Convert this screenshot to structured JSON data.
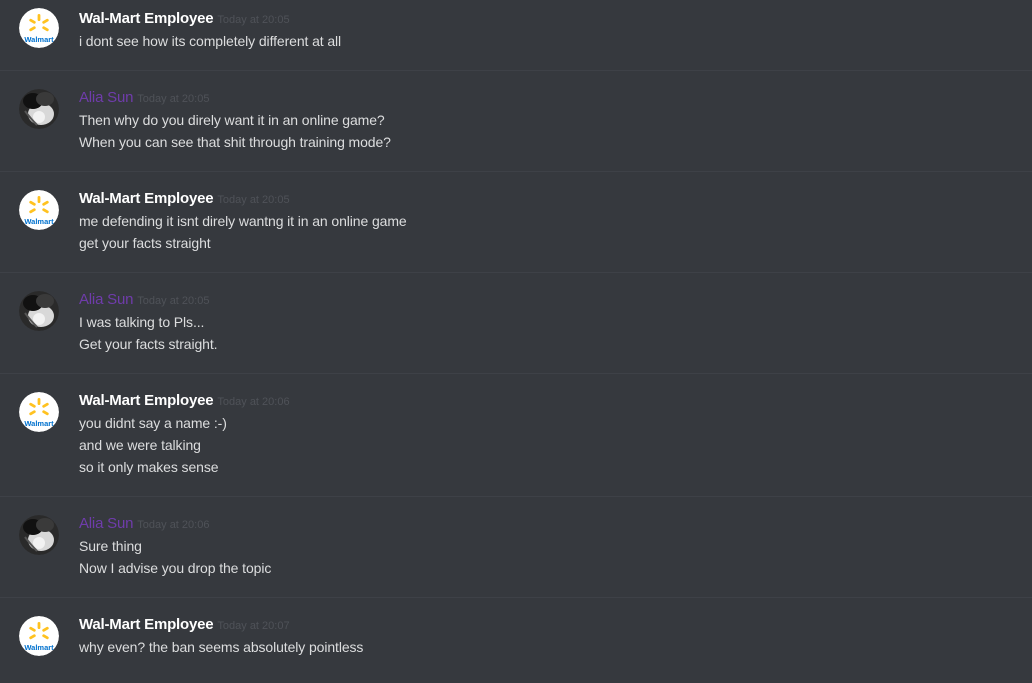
{
  "messages": [
    {
      "author": "Wal-Mart Employee",
      "timestamp": "Today at 20:05",
      "lines": [
        "i dont see how its completely different at all"
      ]
    },
    {
      "author": "Alia Sun",
      "timestamp": "Today at 20:05",
      "lines": [
        "Then why do you direly want it in an online game?",
        "When you can see that shit through training mode?"
      ]
    },
    {
      "author": "Wal-Mart Employee",
      "timestamp": "Today at 20:05",
      "lines": [
        "me defending it isnt direly wantng it in an online game",
        "get your facts straight"
      ]
    },
    {
      "author": "Alia Sun",
      "timestamp": "Today at 20:05",
      "lines": [
        "I was talking to Pls...",
        "Get your facts straight."
      ]
    },
    {
      "author": "Wal-Mart Employee",
      "timestamp": "Today at 20:06",
      "lines": [
        "you didnt say a name :-)",
        "and we were talking",
        "so it only makes sense"
      ]
    },
    {
      "author": "Alia Sun",
      "timestamp": "Today at 20:06",
      "lines": [
        "Sure thing",
        "Now I advise you drop the topic"
      ]
    },
    {
      "author": "Wal-Mart Employee",
      "timestamp": "Today at 20:07",
      "lines": [
        "why even? the ban seems absolutely pointless"
      ]
    }
  ],
  "avatars": {
    "walmart_logo_text": "Walmart"
  },
  "colors": {
    "background": "#36393e",
    "walmart_name": "#ffffff",
    "alia_name": "#6f3cab",
    "timestamp": "#4f5258",
    "message_text": "#dcddde",
    "walmart_spark": "#ffc220",
    "walmart_blue": "#0071ce"
  }
}
